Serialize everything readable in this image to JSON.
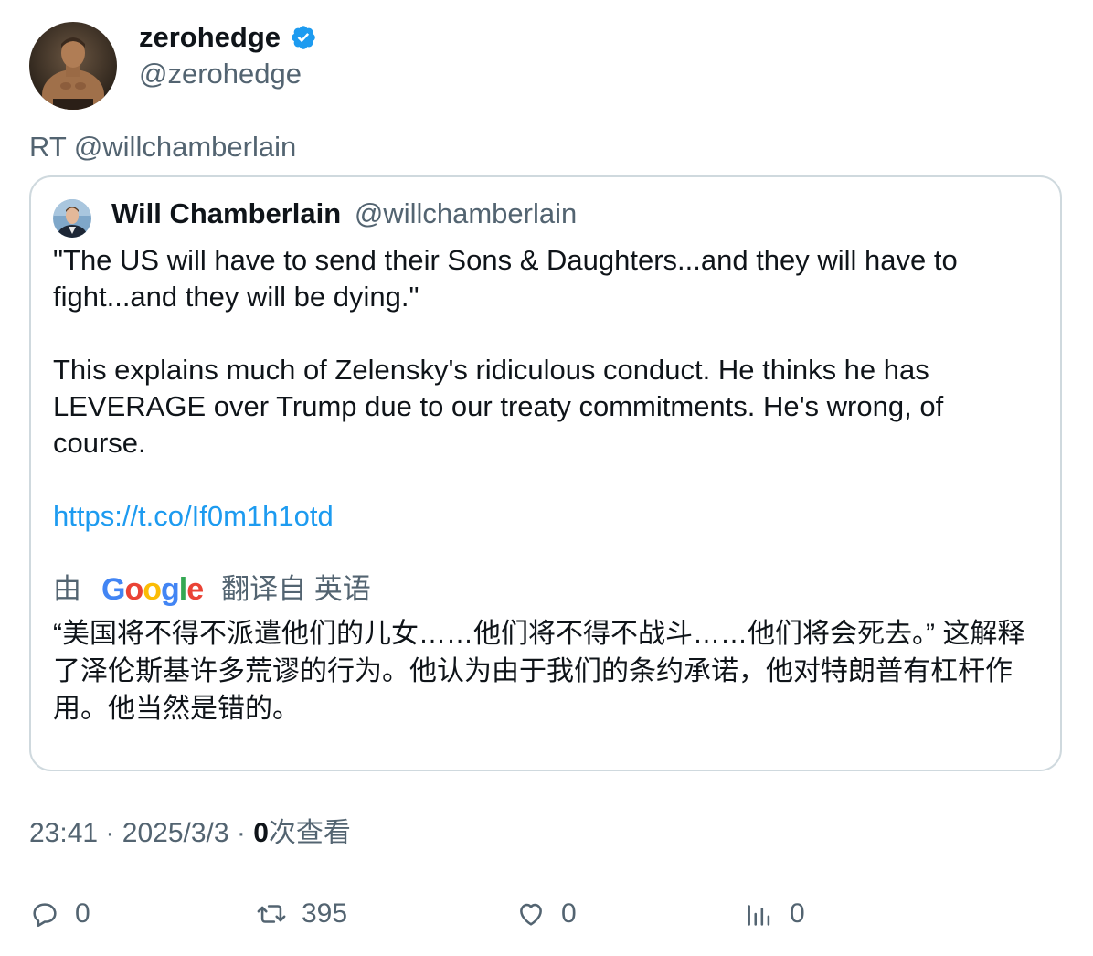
{
  "author": {
    "name": "zerohedge",
    "handle": "@zerohedge",
    "verified": true,
    "verified_color": "#1d9bf0",
    "avatar_icon": "avatar-photo"
  },
  "retweet_line": "RT @willchamberlain",
  "quote": {
    "name": "Will Chamberlain",
    "handle": "@willchamberlain",
    "avatar_icon": "avatar-photo",
    "paragraph1": "\"The US will have to send their Sons & Daughters...and they will have to fight...and they will be dying.\"",
    "paragraph2": "This explains much of Zelensky's ridiculous conduct. He thinks he has LEVERAGE over Trump due to our treaty commitments. He's wrong, of course.",
    "link": "https://t.co/If0m1h1otd",
    "link_color": "#1d9bf0",
    "translate_prefix": "由",
    "translate_brand": "Google",
    "translate_suffix": "翻译自 英语",
    "translation": "“美国将不得不派遣他们的儿女……他们将不得不战斗……他们将会死去。” 这解释了泽伦斯基许多荒谬的行为。他认为由于我们的条约承诺，他对特朗普有杠杆作用。他当然是错的。"
  },
  "meta": {
    "time": "23:41",
    "separator": "·",
    "date": "2025/3/3",
    "views_count": "0",
    "views_label": "次查看"
  },
  "actions": {
    "reply_count": "0",
    "retweet_count": "395",
    "like_count": "0",
    "views_count": "0",
    "icons": [
      "reply-icon",
      "retweet-icon",
      "like-icon",
      "views-icon"
    ]
  }
}
